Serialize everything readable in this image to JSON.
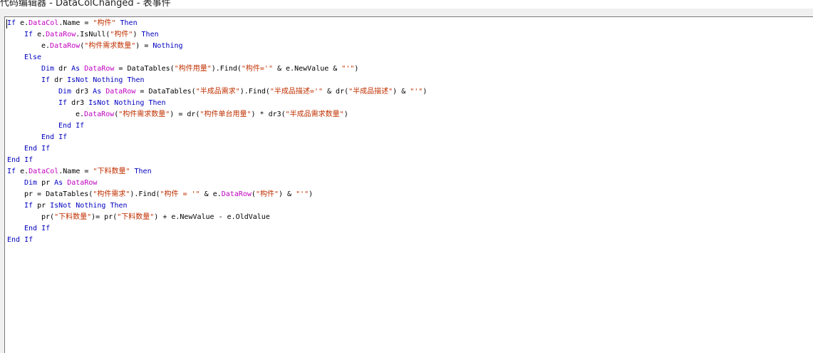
{
  "window": {
    "title": "代码编辑器 - DataColChanged - 表事件"
  },
  "editor": {
    "lines": [
      {
        "indent": 0,
        "tokens": [
          {
            "t": "If",
            "c": "kw"
          },
          {
            "t": " e.",
            "c": "id"
          },
          {
            "t": "DataCol",
            "c": "tbl"
          },
          {
            "t": ".Name = ",
            "c": "id"
          },
          {
            "t": "\"构件\"",
            "c": "str"
          },
          {
            "t": " ",
            "c": "id"
          },
          {
            "t": "Then",
            "c": "kw"
          }
        ]
      },
      {
        "indent": 1,
        "tokens": [
          {
            "t": "If",
            "c": "kw"
          },
          {
            "t": " e.",
            "c": "id"
          },
          {
            "t": "DataRow",
            "c": "tbl"
          },
          {
            "t": ".IsNull(",
            "c": "id"
          },
          {
            "t": "\"构件\"",
            "c": "str"
          },
          {
            "t": ") ",
            "c": "id"
          },
          {
            "t": "Then",
            "c": "kw"
          }
        ]
      },
      {
        "indent": 2,
        "tokens": [
          {
            "t": "e.",
            "c": "id"
          },
          {
            "t": "DataRow",
            "c": "tbl"
          },
          {
            "t": "(",
            "c": "id"
          },
          {
            "t": "\"构件需求数量\"",
            "c": "str"
          },
          {
            "t": ") = ",
            "c": "id"
          },
          {
            "t": "Nothing",
            "c": "kw"
          }
        ]
      },
      {
        "indent": 1,
        "tokens": [
          {
            "t": "Else",
            "c": "kw"
          }
        ]
      },
      {
        "indent": 2,
        "tokens": [
          {
            "t": "Dim",
            "c": "kw"
          },
          {
            "t": " dr ",
            "c": "id"
          },
          {
            "t": "As",
            "c": "kw"
          },
          {
            "t": " ",
            "c": "id"
          },
          {
            "t": "DataRow",
            "c": "tbl"
          },
          {
            "t": " = DataTables(",
            "c": "id"
          },
          {
            "t": "\"构件用量\"",
            "c": "str"
          },
          {
            "t": ").Find(",
            "c": "id"
          },
          {
            "t": "\"构件='\"",
            "c": "str"
          },
          {
            "t": " & e.NewValue & ",
            "c": "id"
          },
          {
            "t": "\"'\"",
            "c": "str"
          },
          {
            "t": ")",
            "c": "id"
          }
        ]
      },
      {
        "indent": 2,
        "tokens": [
          {
            "t": "If",
            "c": "kw"
          },
          {
            "t": " dr ",
            "c": "id"
          },
          {
            "t": "IsNot",
            "c": "kw"
          },
          {
            "t": " ",
            "c": "id"
          },
          {
            "t": "Nothing",
            "c": "kw"
          },
          {
            "t": " ",
            "c": "id"
          },
          {
            "t": "Then",
            "c": "kw"
          }
        ]
      },
      {
        "indent": 3,
        "tokens": [
          {
            "t": "Dim",
            "c": "kw"
          },
          {
            "t": " dr3 ",
            "c": "id"
          },
          {
            "t": "As",
            "c": "kw"
          },
          {
            "t": " ",
            "c": "id"
          },
          {
            "t": "DataRow",
            "c": "tbl"
          },
          {
            "t": " = DataTables(",
            "c": "id"
          },
          {
            "t": "\"半成品需求\"",
            "c": "str"
          },
          {
            "t": ").Find(",
            "c": "id"
          },
          {
            "t": "\"半成品描述='\"",
            "c": "str"
          },
          {
            "t": " & dr(",
            "c": "id"
          },
          {
            "t": "\"半成品描述\"",
            "c": "str"
          },
          {
            "t": ") & ",
            "c": "id"
          },
          {
            "t": "\"'\"",
            "c": "str"
          },
          {
            "t": ")",
            "c": "id"
          }
        ]
      },
      {
        "indent": 3,
        "tokens": [
          {
            "t": "If",
            "c": "kw"
          },
          {
            "t": " dr3 ",
            "c": "id"
          },
          {
            "t": "IsNot",
            "c": "kw"
          },
          {
            "t": " ",
            "c": "id"
          },
          {
            "t": "Nothing",
            "c": "kw"
          },
          {
            "t": " ",
            "c": "id"
          },
          {
            "t": "Then",
            "c": "kw"
          }
        ]
      },
      {
        "indent": 4,
        "tokens": [
          {
            "t": "e.",
            "c": "id"
          },
          {
            "t": "DataRow",
            "c": "tbl"
          },
          {
            "t": "(",
            "c": "id"
          },
          {
            "t": "\"构件需求数量\"",
            "c": "str"
          },
          {
            "t": ") = dr(",
            "c": "id"
          },
          {
            "t": "\"构件单台用量\"",
            "c": "str"
          },
          {
            "t": ") * dr3(",
            "c": "id"
          },
          {
            "t": "\"半成品需求数量\"",
            "c": "str"
          },
          {
            "t": ")",
            "c": "id"
          }
        ]
      },
      {
        "indent": 3,
        "tokens": [
          {
            "t": "End If",
            "c": "kw"
          }
        ]
      },
      {
        "indent": 2,
        "tokens": [
          {
            "t": "End If",
            "c": "kw"
          }
        ]
      },
      {
        "indent": 1,
        "tokens": [
          {
            "t": "End If",
            "c": "kw"
          }
        ]
      },
      {
        "indent": 0,
        "tokens": [
          {
            "t": "End If",
            "c": "kw"
          }
        ]
      },
      {
        "indent": 0,
        "tokens": [
          {
            "t": "If",
            "c": "kw"
          },
          {
            "t": " e.",
            "c": "id"
          },
          {
            "t": "DataCol",
            "c": "tbl"
          },
          {
            "t": ".Name = ",
            "c": "id"
          },
          {
            "t": "\"下料数量\"",
            "c": "str"
          },
          {
            "t": " ",
            "c": "id"
          },
          {
            "t": "Then",
            "c": "kw"
          }
        ]
      },
      {
        "indent": 1,
        "tokens": [
          {
            "t": "Dim",
            "c": "kw"
          },
          {
            "t": " pr ",
            "c": "id"
          },
          {
            "t": "As",
            "c": "kw"
          },
          {
            "t": " ",
            "c": "id"
          },
          {
            "t": "DataRow",
            "c": "tbl"
          }
        ]
      },
      {
        "indent": 1,
        "tokens": [
          {
            "t": "pr = DataTables(",
            "c": "id"
          },
          {
            "t": "\"构件需求\"",
            "c": "str"
          },
          {
            "t": ").Find(",
            "c": "id"
          },
          {
            "t": "\"构件 = '\"",
            "c": "str"
          },
          {
            "t": " & e.",
            "c": "id"
          },
          {
            "t": "DataRow",
            "c": "tbl"
          },
          {
            "t": "(",
            "c": "id"
          },
          {
            "t": "\"构件\"",
            "c": "str"
          },
          {
            "t": ") & ",
            "c": "id"
          },
          {
            "t": "\"'\"",
            "c": "str"
          },
          {
            "t": ")",
            "c": "id"
          }
        ]
      },
      {
        "indent": 1,
        "tokens": [
          {
            "t": "If",
            "c": "kw"
          },
          {
            "t": " pr ",
            "c": "id"
          },
          {
            "t": "IsNot",
            "c": "kw"
          },
          {
            "t": " ",
            "c": "id"
          },
          {
            "t": "Nothing",
            "c": "kw"
          },
          {
            "t": " ",
            "c": "id"
          },
          {
            "t": "Then",
            "c": "kw"
          }
        ]
      },
      {
        "indent": 2,
        "tokens": [
          {
            "t": "pr(",
            "c": "id"
          },
          {
            "t": "\"下料数量\"",
            "c": "str"
          },
          {
            "t": ")= pr(",
            "c": "id"
          },
          {
            "t": "\"下料数量\"",
            "c": "str"
          },
          {
            "t": ") + e.NewValue - e.OldValue",
            "c": "id"
          }
        ]
      },
      {
        "indent": 1,
        "tokens": [
          {
            "t": "End If",
            "c": "kw"
          }
        ]
      },
      {
        "indent": 0,
        "tokens": [
          {
            "t": "End If",
            "c": "kw"
          }
        ]
      }
    ]
  },
  "colors": {
    "keyword": "#0000c0",
    "table_object": "#c000c0",
    "string": "#c03000",
    "identifier": "#000000",
    "background": "#ffffff"
  }
}
